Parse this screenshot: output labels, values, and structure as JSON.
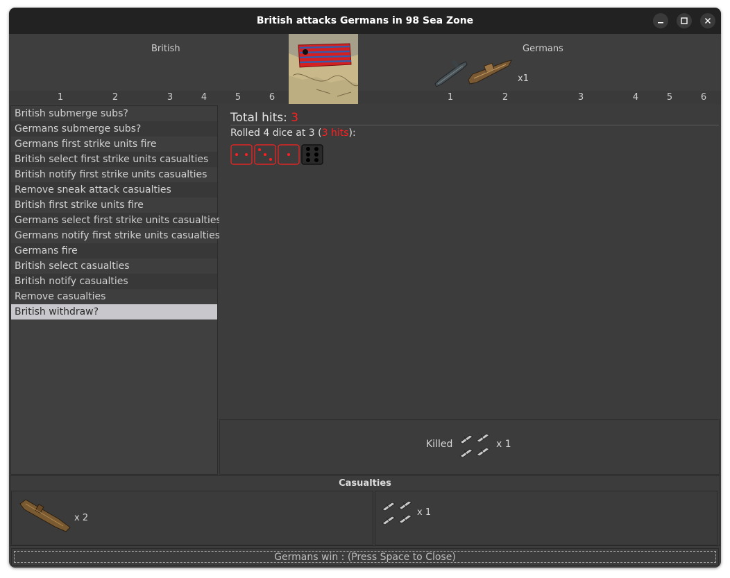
{
  "window": {
    "title": "British attacks Germans in 98 Sea Zone"
  },
  "titlebar_buttons": [
    "minimize-icon",
    "maximize-icon",
    "close-icon"
  ],
  "attacker": {
    "label": "British",
    "dice_scale": [
      "1",
      "2",
      "3",
      "4",
      "5",
      "6"
    ]
  },
  "defender": {
    "label": "Germans",
    "unit_count": "x1",
    "dice_scale": [
      "1",
      "2",
      "3",
      "4",
      "5",
      "6"
    ]
  },
  "steps": [
    "British submerge subs?",
    "Germans submerge subs?",
    "Germans first strike units fire",
    "British select first strike units casualties",
    "British notify first strike units casualties",
    "Remove sneak attack casualties",
    "British first strike units fire",
    "Germans select first strike units casualties",
    "Germans notify first strike units casualties",
    "Germans fire",
    "British select casualties",
    "British notify casualties",
    "Remove casualties",
    "British withdraw?"
  ],
  "selected_step": 13,
  "results": {
    "total_label": "Total hits: ",
    "total_value": "3",
    "rolled_prefix": "Rolled 4 dice at 3 (",
    "rolled_hits": "3 hits",
    "rolled_suffix": "):",
    "dice": [
      2,
      3,
      1,
      6
    ],
    "hit_color": "#ff1f1f"
  },
  "killed": {
    "label": "Killed",
    "count": "x 1"
  },
  "casualties": {
    "title": "Casualties",
    "attacker_count": "x 2",
    "defender_count": "x 1"
  },
  "status": "Germans win : (Press Space to Close)"
}
